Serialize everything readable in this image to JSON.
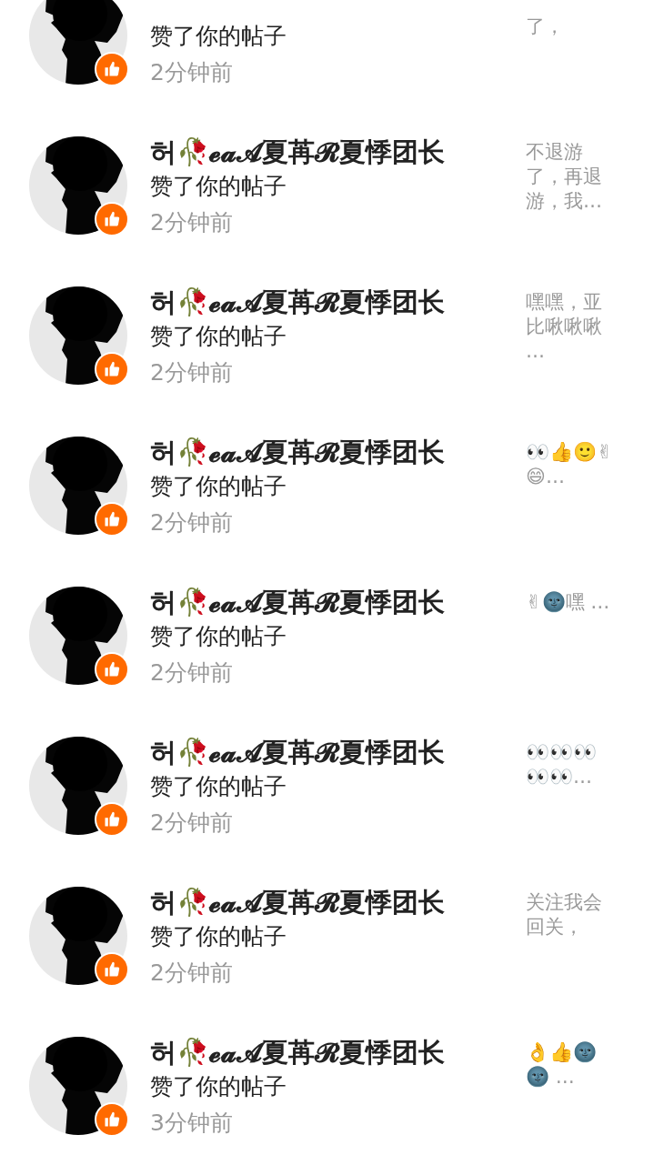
{
  "notifications": [
    {
      "action": "赞了你的帖子",
      "time": "2分钟前",
      "snippet": "了，"
    },
    {
      "name": "허🥀𝓮𝓪𝓐夏苒𝓡夏悸团长",
      "action": "赞了你的帖子",
      "time": "2分钟前",
      "snippet": "不退游了，再退游，我…"
    },
    {
      "name": "허🥀𝓮𝓪𝓐夏苒𝓡夏悸团长",
      "action": "赞了你的帖子",
      "time": "2分钟前",
      "snippet": "嘿嘿，亚比啾啾啾 …"
    },
    {
      "name": "허🥀𝓮𝓪𝓐夏苒𝓡夏悸团长",
      "action": "赞了你的帖子",
      "time": "2分钟前",
      "snippet": "👀👍🙂✌😄…"
    },
    {
      "name": "허🥀𝓮𝓪𝓐夏苒𝓡夏悸团长",
      "action": "赞了你的帖子",
      "time": "2分钟前",
      "snippet": "✌🌚嘿 …"
    },
    {
      "name": "허🥀𝓮𝓪𝓐夏苒𝓡夏悸团长",
      "action": "赞了你的帖子",
      "time": "2分钟前",
      "snippet": "👀👀👀👀👀…"
    },
    {
      "name": "허🥀𝓮𝓪𝓐夏苒𝓡夏悸团长",
      "action": "赞了你的帖子",
      "time": "2分钟前",
      "snippet": "关注我会回关，"
    },
    {
      "name": "허🥀𝓮𝓪𝓐夏苒𝓡夏悸团长",
      "action": "赞了你的帖子",
      "time": "3分钟前",
      "snippet": "👌👍🌚🌚 …"
    }
  ]
}
